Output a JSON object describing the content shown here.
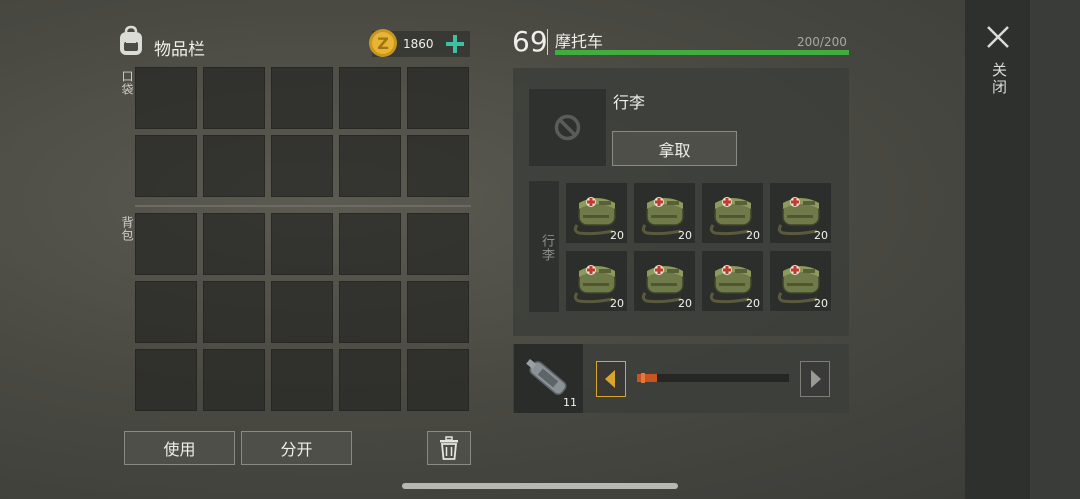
{
  "inventory": {
    "title": "物品栏",
    "coins": "1860",
    "pocket_label": "口袋",
    "backpack_label": "背包",
    "use_label": "使用",
    "split_label": "分开"
  },
  "vehicle": {
    "level": "69",
    "name": "摩托车",
    "durability": "200/200",
    "durability_fraction": 1.0,
    "trunk_title": "行李",
    "take_label": "拿取",
    "trunk_side_label": "行李",
    "items": [
      {
        "icon": "medical-bag-icon",
        "count": "20"
      },
      {
        "icon": "medical-bag-icon",
        "count": "20"
      },
      {
        "icon": "medical-bag-icon",
        "count": "20"
      },
      {
        "icon": "medical-bag-icon",
        "count": "20"
      },
      {
        "icon": "medical-bag-icon",
        "count": "20"
      },
      {
        "icon": "medical-bag-icon",
        "count": "20"
      },
      {
        "icon": "medical-bag-icon",
        "count": "20"
      },
      {
        "icon": "medical-bag-icon",
        "count": "20"
      }
    ]
  },
  "fuel": {
    "count": "11",
    "icon": "fuel-bottle-icon"
  },
  "close_label": "关闭",
  "colors": {
    "durability_bar": "#3fae3f",
    "coin": "#e0b132",
    "plus": "#3fbfa3",
    "arrow_gold": "#d9a52a"
  }
}
